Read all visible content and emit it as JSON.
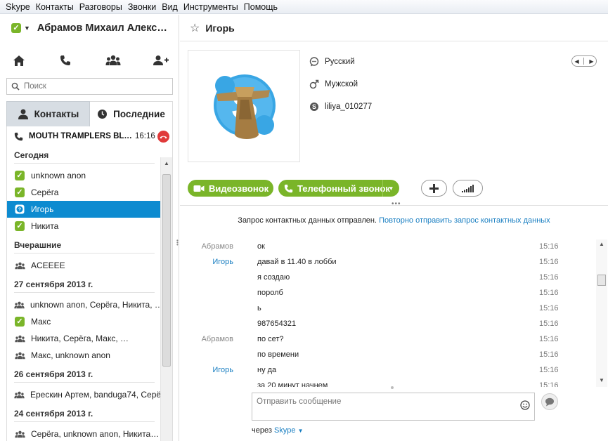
{
  "menu": [
    "Skype",
    "Контакты",
    "Разговоры",
    "Звонки",
    "Вид",
    "Инструменты",
    "Помощь"
  ],
  "user": {
    "name": "Абрамов Михаил Алекс…"
  },
  "search": {
    "placeholder": "Поиск"
  },
  "tabs": {
    "contacts": "Контакты",
    "recent": "Последние"
  },
  "active_call": {
    "name": "MOUTH TRAMPLERS BL…",
    "time": "16:16"
  },
  "sections": {
    "today": "Сегодня",
    "yesterday": "Вчерашние",
    "sep27": "27 сентября 2013 г.",
    "sep26": "26 сентября 2013 г.",
    "sep24": "24 сентября 2013 г."
  },
  "contacts": {
    "today": [
      "unknown anon",
      "Серёга",
      "Игорь",
      "Никита"
    ],
    "yesterday": [
      "ACEEEE"
    ],
    "sep27": [
      "unknown anon, Серёга, Никита, …",
      "Макс",
      "Никита, Серёга, Макс, …",
      "Макс, unknown anon"
    ],
    "sep26": [
      "Ерескин Артем, banduga74, Серё…"
    ],
    "sep24": [
      "Серёга, unknown anon, Никита…"
    ]
  },
  "profile": {
    "name": "Игорь",
    "language": "Русский",
    "gender": "Мужской",
    "skype_id": "liliya_010277"
  },
  "buttons": {
    "video_call": "Видеозвонок",
    "phone_call": "Телефонный звонок"
  },
  "request": {
    "text": "Запрос контактных данных отправлен.",
    "link": "Повторно отправить запрос контактных данных"
  },
  "messages": [
    {
      "author": "Абрамов",
      "text": "ок",
      "time": "15:16"
    },
    {
      "author": "Игорь",
      "text": "давай в 11.40 в лобби",
      "time": "15:16"
    },
    {
      "author": "",
      "text": "я создаю",
      "time": "15:16"
    },
    {
      "author": "",
      "text": "поролб",
      "time": "15:16"
    },
    {
      "author": "",
      "text": "ь",
      "time": "15:16"
    },
    {
      "author": "",
      "text": "987654321",
      "time": "15:16"
    },
    {
      "author": "Абрамов",
      "text": "по сет?",
      "time": "15:16"
    },
    {
      "author": "",
      "text": "по времени",
      "time": "15:16"
    },
    {
      "author": "Игорь",
      "text": "ну да",
      "time": "15:16"
    },
    {
      "author": "",
      "text": "за 20 минут начнем",
      "time": "15:16"
    }
  ],
  "compose": {
    "placeholder": "Отправить сообщение"
  },
  "via": {
    "label": "через",
    "service": "Skype"
  },
  "colors": {
    "accent_green": "#7ab529",
    "selection_blue": "#0d8bd0",
    "link_blue": "#1a7fc2",
    "hangup_red": "#e03a3a"
  }
}
